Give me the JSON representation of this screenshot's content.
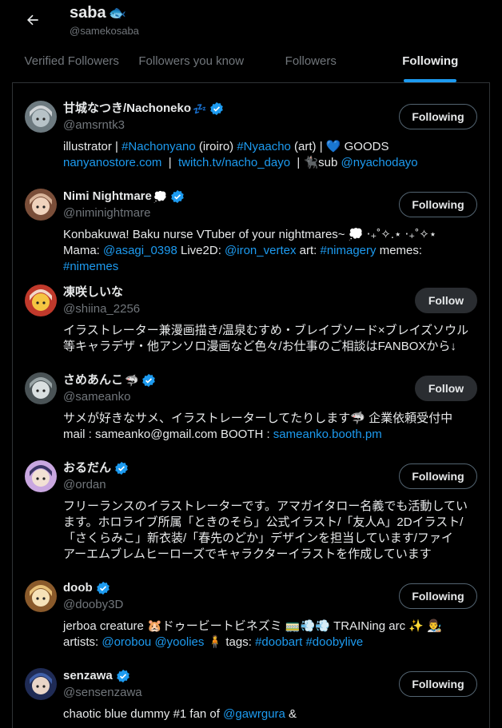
{
  "header": {
    "back_icon": "arrow-left-icon",
    "title": "saba",
    "title_emoji": "🐟",
    "handle": "@samekosaba"
  },
  "tabs": [
    {
      "label": "Verified Followers",
      "active": false
    },
    {
      "label": "Followers you know",
      "active": false
    },
    {
      "label": "Followers",
      "active": false
    },
    {
      "label": "Following",
      "active": true
    }
  ],
  "colors": {
    "accent": "#1d9bf0",
    "text": "#e7e9ea",
    "muted": "#71767b",
    "border": "#2f3336",
    "background": "#000000"
  },
  "users": [
    {
      "name": "甘城なつき/Nachoneko",
      "name_emoji": "💤",
      "verified": true,
      "handle": "@amsrntk3",
      "button": "Following",
      "bio": [
        {
          "t": "illustrator | "
        },
        {
          "t": "#Nachonyano",
          "link": true
        },
        {
          "t": " (iroiro) "
        },
        {
          "t": "#Nyaacho",
          "link": true
        },
        {
          "t": " (art) | 💙 GOODS\n"
        },
        {
          "t": "nanyanostore.com",
          "link": true
        },
        {
          "t": "  |  "
        },
        {
          "t": "twitch.tv/nacho_dayo",
          "link": true
        },
        {
          "t": "  | 🐈‍⬛sub "
        },
        {
          "t": "@nyachodayo",
          "link": true
        }
      ]
    },
    {
      "name": "Nimi Nightmare",
      "name_emoji": "💭",
      "verified": true,
      "handle": "@niminightmare",
      "button": "Following",
      "bio": [
        {
          "t": "Konbakuwa! Baku nurse VTuber of your nightmares~ 💭 ‧₊˚✧.⋆ ‧₊˚✧⋆\n"
        },
        {
          "t": "Mama: "
        },
        {
          "t": "@asagi_0398",
          "link": true
        },
        {
          "t": " Live2D: "
        },
        {
          "t": "@iron_vertex",
          "link": true
        },
        {
          "t": " art: "
        },
        {
          "t": "#nimagery",
          "link": true
        },
        {
          "t": " memes:\n"
        },
        {
          "t": "#nimemes",
          "link": true
        }
      ]
    },
    {
      "name": "凍咲しいな",
      "name_emoji": "",
      "verified": false,
      "handle": "@shiina_2256",
      "button": "Follow",
      "bio": [
        {
          "t": "イラストレーター兼漫画描き/温泉むすめ・ブレイブソード×ブレイズソウル\n等キャラデザ・他アンソロ漫画など色々/お仕事のご相談はFANBOXから↓"
        }
      ]
    },
    {
      "name": "さめあんこ",
      "name_emoji": "🦈",
      "verified": true,
      "handle": "@sameanko",
      "button": "Follow",
      "bio": [
        {
          "t": "サメが好きなサメ、イラストレーターしてたりします🦈 企業依頼受付中\n"
        },
        {
          "t": "mail : sameanko@gmail.com BOOTH : "
        },
        {
          "t": "sameanko.booth.pm",
          "link": true
        }
      ]
    },
    {
      "name": "おるだん",
      "name_emoji": "",
      "verified": true,
      "handle": "@ordan",
      "button": "Following",
      "bio": [
        {
          "t": "フリーランスのイラストレーターです。アマガイタロー名義でも活動してい\nます。ホロライブ所属「ときのそら」公式イラスト/「友人A」2Dイラスト/\n「さくらみこ」新衣装/「春先のどか」デザインを担当しています/ファイ\nアーエムブレムヒーローズでキャラクターイラストを作成しています"
        }
      ]
    },
    {
      "name": "doob",
      "name_emoji": "",
      "verified": true,
      "handle": "@dooby3D",
      "button": "Following",
      "bio": [
        {
          "t": "jerboa creature 🐹ドゥービートビネズミ 🚃💨💨 TRAINing arc ✨ 👨‍🎨\n"
        },
        {
          "t": "artists: "
        },
        {
          "t": "@orobou",
          "link": true
        },
        {
          "t": " "
        },
        {
          "t": "@yoolies",
          "link": true
        },
        {
          "t": " 🧍 tags: "
        },
        {
          "t": "#doobart",
          "link": true
        },
        {
          "t": " "
        },
        {
          "t": "#doobylive",
          "link": true
        }
      ]
    },
    {
      "name": "senzawa",
      "name_emoji": "",
      "verified": true,
      "handle": "@sensenzawa",
      "button": "Following",
      "bio": [
        {
          "t": "chaotic blue dummy #1 fan of "
        },
        {
          "t": "@gawrgura",
          "link": true
        },
        {
          "t": " &"
        }
      ]
    }
  ]
}
